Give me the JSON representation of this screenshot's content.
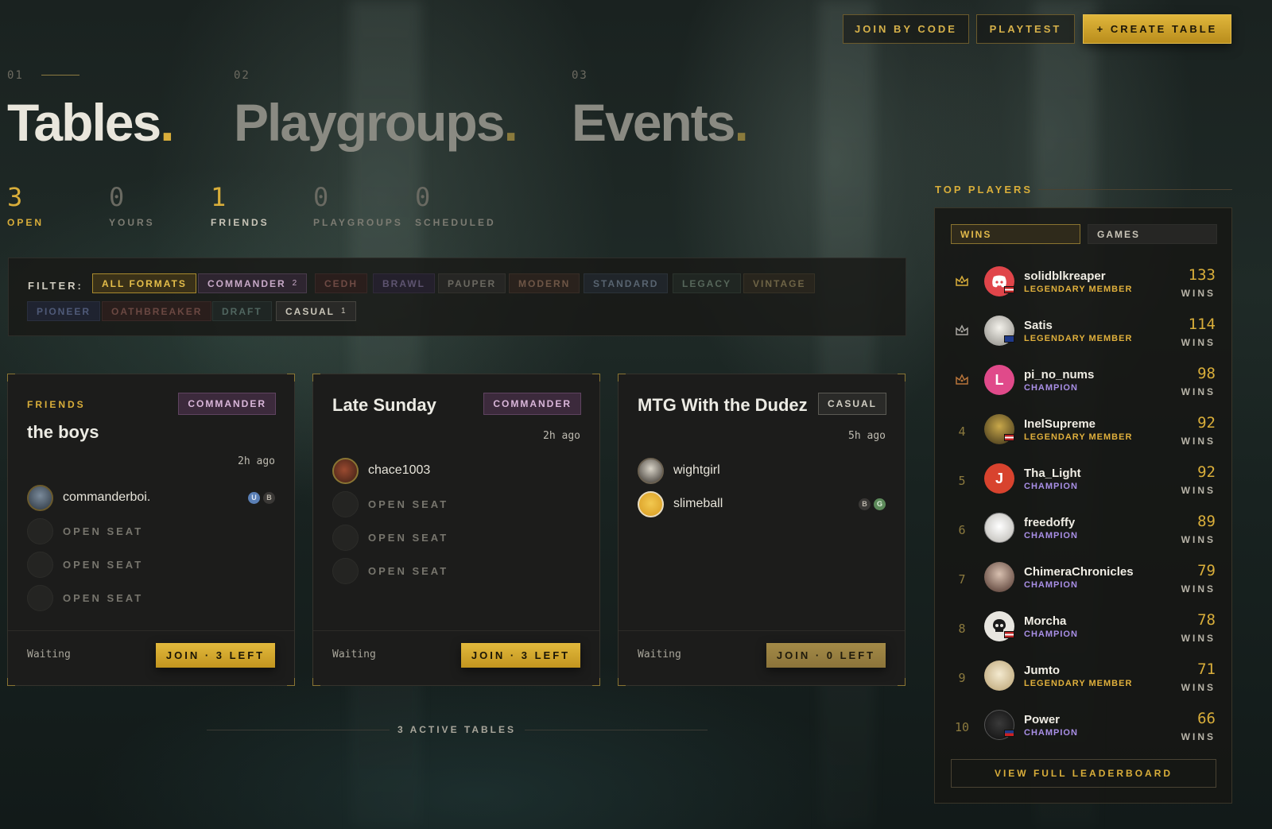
{
  "header": {
    "join_by_code": "JOIN BY CODE",
    "playtest": "PLAYTEST",
    "create_table": "+ CREATE TABLE"
  },
  "sections": [
    {
      "num": "01",
      "title": "Tables",
      "dot": "."
    },
    {
      "num": "02",
      "title": "Playgroups",
      "dot": "."
    },
    {
      "num": "03",
      "title": "Events",
      "dot": "."
    }
  ],
  "stats": [
    {
      "value": "3",
      "label": "OPEN"
    },
    {
      "value": "0",
      "label": "YOURS"
    },
    {
      "value": "1",
      "label": "FRIENDS"
    },
    {
      "value": "0",
      "label": "PLAYGROUPS"
    },
    {
      "value": "0",
      "label": "SCHEDULED"
    }
  ],
  "filter": {
    "label": "FILTER:",
    "chips": [
      {
        "label": "ALL FORMATS",
        "count": ""
      },
      {
        "label": "COMMANDER",
        "count": "2"
      },
      {
        "label": "CEDH",
        "count": ""
      },
      {
        "label": "BRAWL",
        "count": ""
      },
      {
        "label": "PAUPER",
        "count": ""
      },
      {
        "label": "MODERN",
        "count": ""
      },
      {
        "label": "STANDARD",
        "count": ""
      },
      {
        "label": "LEGACY",
        "count": ""
      },
      {
        "label": "VINTAGE",
        "count": ""
      },
      {
        "label": "PIONEER",
        "count": ""
      },
      {
        "label": "OATHBREAKER",
        "count": ""
      },
      {
        "label": "DRAFT",
        "count": ""
      },
      {
        "label": "CASUAL",
        "count": "1"
      }
    ]
  },
  "tables": [
    {
      "badge": "FRIENDS",
      "title": "the boys",
      "format": "COMMANDER",
      "ago": "2h ago",
      "players": [
        {
          "name": "commanderboi.",
          "pips": [
            "U",
            "B"
          ]
        }
      ],
      "open_seat_label": "OPEN SEAT",
      "status": "Waiting",
      "join": "JOIN · 3 LEFT"
    },
    {
      "badge": "",
      "title": "Late Sunday",
      "format": "COMMANDER",
      "ago": "2h ago",
      "players": [
        {
          "name": "chace1003",
          "pips": []
        }
      ],
      "open_seat_label": "OPEN SEAT",
      "status": "Waiting",
      "join": "JOIN · 3 LEFT"
    },
    {
      "badge": "",
      "title": "MTG With the Dudez",
      "format": "CASUAL",
      "ago": "5h ago",
      "players": [
        {
          "name": "wightgirl",
          "pips": []
        },
        {
          "name": "slimeball",
          "pips": [
            "B",
            "G"
          ]
        }
      ],
      "open_seat_label": "OPEN SEAT",
      "status": "Waiting",
      "join": "JOIN · 0 LEFT"
    }
  ],
  "footer": {
    "active_tables": "3 ACTIVE TABLES"
  },
  "leaderboard": {
    "heading": "TOP PLAYERS",
    "tabs": [
      "WINS",
      "GAMES"
    ],
    "wins_label": "WINS",
    "view_full": "VIEW FULL LEADERBOARD",
    "players": [
      {
        "rank": "1",
        "name": "solidblkreaper",
        "tier": "LEGENDARY MEMBER",
        "wins": "133",
        "avatar": "discord-icon",
        "initial": ""
      },
      {
        "rank": "2",
        "name": "Satis",
        "tier": "LEGENDARY MEMBER",
        "wins": "114",
        "avatar": "portrait",
        "initial": ""
      },
      {
        "rank": "3",
        "name": "pi_no_nums",
        "tier": "CHAMPION",
        "wins": "98",
        "avatar": "initial",
        "initial": "L"
      },
      {
        "rank": "4",
        "name": "InelSupreme",
        "tier": "LEGENDARY MEMBER",
        "wins": "92",
        "avatar": "portrait",
        "initial": ""
      },
      {
        "rank": "5",
        "name": "Tha_Light",
        "tier": "CHAMPION",
        "wins": "92",
        "avatar": "initial",
        "initial": "J"
      },
      {
        "rank": "6",
        "name": "freedoffy",
        "tier": "CHAMPION",
        "wins": "89",
        "avatar": "portrait",
        "initial": ""
      },
      {
        "rank": "7",
        "name": "ChimeraChronicles",
        "tier": "CHAMPION",
        "wins": "79",
        "avatar": "portrait",
        "initial": ""
      },
      {
        "rank": "8",
        "name": "Morcha",
        "tier": "CHAMPION",
        "wins": "78",
        "avatar": "skull-icon",
        "initial": ""
      },
      {
        "rank": "9",
        "name": "Jumto",
        "tier": "LEGENDARY MEMBER",
        "wins": "71",
        "avatar": "portrait",
        "initial": ""
      },
      {
        "rank": "10",
        "name": "Power",
        "tier": "CHAMPION",
        "wins": "66",
        "avatar": "portrait",
        "initial": ""
      }
    ]
  },
  "colors": {
    "accent": "#d9ae3a",
    "champion": "#a98fe6",
    "legendary": "#e0b03c"
  }
}
